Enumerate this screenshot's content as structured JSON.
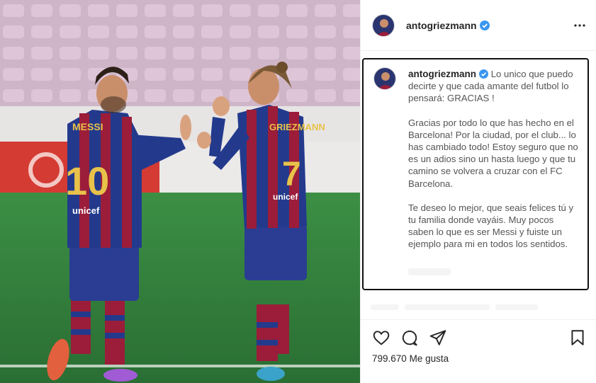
{
  "post": {
    "username": "antogriezmann",
    "verified": true,
    "caption": {
      "paragraphs": [
        "Lo unico que puedo decirte y que cada amante del futbol lo pensará: GRACIAS !",
        "Gracias por todo lo que has hecho en el Barcelona! Por la ciudad, por el club... lo has cambiado todo! Estoy seguro que no es un adios sino un hasta luego y que tu camino se volvera a cruzar con el FC Barcelona.",
        "Te deseo lo mejor, que seais felices tú y tu familia donde vayáis. Muy pocos saben lo que es ser Messi y fuiste un ejemplo para mi en todos los sentidos."
      ]
    },
    "likes_count": "799.670",
    "likes_label": "Me gusta"
  },
  "photo": {
    "left_player": {
      "name": "MESSI",
      "number": "10"
    },
    "right_player": {
      "name": "GRIEZMANN",
      "number": "7"
    },
    "sponsor": "unicef",
    "colors": {
      "sky_stands": "#b9a0b4",
      "pitch": "#2f7a3a",
      "shirt_blue": "#233a8c",
      "shirt_red": "#9b1d3a",
      "shorts": "#2a3d92",
      "number_gold": "#e8c24a"
    }
  },
  "icons": {
    "verified": "verified-badge-icon",
    "more": "more-options-icon",
    "like": "heart-icon",
    "comment": "comment-icon",
    "share": "paper-plane-icon",
    "save": "bookmark-icon"
  },
  "colors": {
    "verified_blue": "#3897f0",
    "text": "#262626",
    "muted_text": "#555555",
    "border": "#efefef"
  }
}
